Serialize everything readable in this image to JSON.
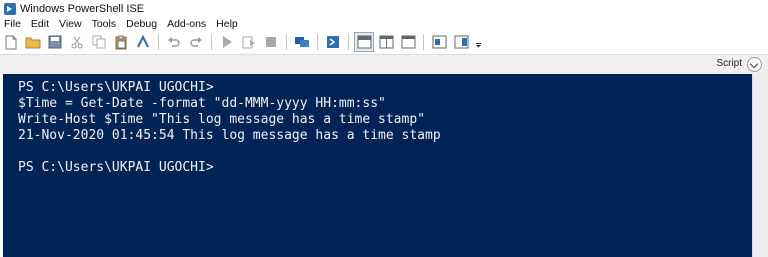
{
  "window": {
    "title": "Windows PowerShell ISE",
    "app_icon": "powershell-icon"
  },
  "menu": {
    "items": [
      "File",
      "Edit",
      "View",
      "Tools",
      "Debug",
      "Add-ons",
      "Help"
    ]
  },
  "toolbar": {
    "buttons": [
      "new-file-icon",
      "open-folder-icon",
      "save-icon",
      "cut-icon",
      "copy-icon",
      "paste-icon",
      "clear-console-icon",
      "undo-icon",
      "redo-icon",
      "run-script-icon",
      "run-selection-icon",
      "stop-icon",
      "remote-powershell-icon",
      "new-powershell-tab-icon",
      "show-script-pane-top-icon",
      "show-script-pane-right-icon",
      "show-script-pane-maximized-icon",
      "show-command-window-icon",
      "show-command-addon-icon",
      "toolbar-overflow-icon"
    ]
  },
  "panel": {
    "script_label": "Script",
    "collapse_icon": "chevron-down-icon"
  },
  "console": {
    "background": "#012456",
    "foreground": "#f2f2f2",
    "lines": [
      "PS C:\\Users\\UKPAI UGOCHI>",
      "$Time = Get-Date -format \"dd-MMM-yyyy HH:mm:ss\"",
      "Write-Host $Time \"This log message has a time stamp\"",
      "21-Nov-2020 01:45:54 This log message has a time stamp",
      "",
      "PS C:\\Users\\UKPAI UGOCHI>"
    ]
  }
}
